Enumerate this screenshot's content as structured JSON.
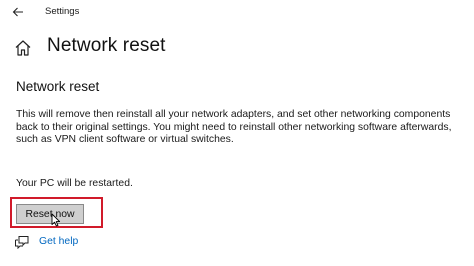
{
  "window": {
    "app_title": "Settings"
  },
  "header": {
    "title": "Network reset"
  },
  "main": {
    "section_title": "Network reset",
    "description": "This will remove then reinstall all your network adapters, and set other networking components back to their original settings. You might need to reinstall other networking software afterwards, such as VPN client software or virtual switches.",
    "restart_note": "Your PC will be restarted.",
    "reset_button_label": "Reset now",
    "help_link": "Get help"
  },
  "icons": {
    "back": "back-arrow-icon",
    "home": "home-icon",
    "help": "help-chat-icon",
    "cursor": "mouse-pointer-icon"
  },
  "colors": {
    "highlight": "#d11a2a",
    "link": "#0067c0",
    "button_bg": "#cfcfcf"
  }
}
